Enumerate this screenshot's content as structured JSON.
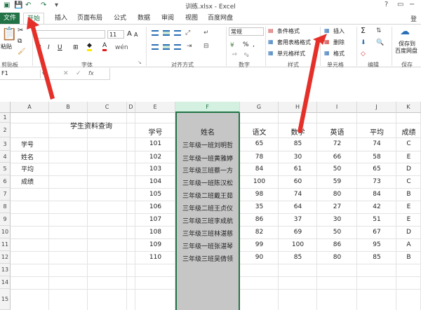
{
  "window": {
    "title": "训练.xlsx - Excel",
    "login": "登",
    "help": "?"
  },
  "tabs": [
    "文件",
    "开始",
    "插入",
    "页面布局",
    "公式",
    "数据",
    "审阅",
    "视图",
    "百度网盘"
  ],
  "ribbon": {
    "clipboard": {
      "paste": "粘贴",
      "label": "剪贴板"
    },
    "font": {
      "size": "11",
      "bold": "B",
      "italic": "I",
      "underline": "U",
      "label": "字体",
      "grow": "A",
      "shrink": "A"
    },
    "alignment": {
      "label": "对齐方式"
    },
    "number": {
      "format": "常规",
      "percent": "%",
      "comma": ",",
      "label": "数字"
    },
    "styles": {
      "conditional": "条件格式",
      "table": "套用表格格式",
      "cell": "单元格样式",
      "label": "样式"
    },
    "cells": {
      "insert": "插入",
      "delete": "删除",
      "format": "格式",
      "label": "单元格"
    },
    "editing": {
      "sum": "Σ",
      "label": "编辑"
    },
    "save": {
      "line1": "保存到",
      "line2": "百度网盘",
      "label": "保存"
    }
  },
  "formula_bar": {
    "name_box": "F1",
    "fx": "fx"
  },
  "columns": [
    "A",
    "B",
    "C",
    "D",
    "E",
    "F",
    "G",
    "H",
    "I",
    "J",
    "K"
  ],
  "rows": [
    "1",
    "2",
    "3",
    "4",
    "5",
    "6",
    "7",
    "8",
    "9",
    "10",
    "11",
    "12",
    "13",
    "14",
    "15"
  ],
  "lookup": {
    "title": "学生资料查询",
    "labels": [
      "学号",
      "姓名",
      "平均",
      "成绩"
    ]
  },
  "table": {
    "headers": [
      "学号",
      "姓名",
      "语文",
      "数学",
      "英语",
      "平均",
      "成绩"
    ],
    "rows": [
      [
        "101",
        "三年级一班刘明哲",
        "65",
        "85",
        "72",
        "74",
        "C"
      ],
      [
        "102",
        "三年级一班黄雅婷",
        "78",
        "30",
        "66",
        "58",
        "E"
      ],
      [
        "103",
        "三年级三班蔡一方",
        "84",
        "61",
        "50",
        "65",
        "D"
      ],
      [
        "104",
        "三年级一班陈汉松",
        "100",
        "60",
        "59",
        "73",
        "C"
      ],
      [
        "105",
        "三年级二班戴王茹",
        "98",
        "74",
        "80",
        "84",
        "B"
      ],
      [
        "106",
        "三年级二班王贞仪",
        "35",
        "64",
        "27",
        "42",
        "E"
      ],
      [
        "107",
        "三年级三班李成航",
        "86",
        "37",
        "30",
        "51",
        "E"
      ],
      [
        "108",
        "三年级三班林湛慈",
        "82",
        "69",
        "50",
        "67",
        "D"
      ],
      [
        "109",
        "三年级一班张湛琴",
        "99",
        "100",
        "86",
        "95",
        "A"
      ],
      [
        "110",
        "三年级三班吴倩领",
        "90",
        "85",
        "80",
        "85",
        "B"
      ]
    ]
  }
}
